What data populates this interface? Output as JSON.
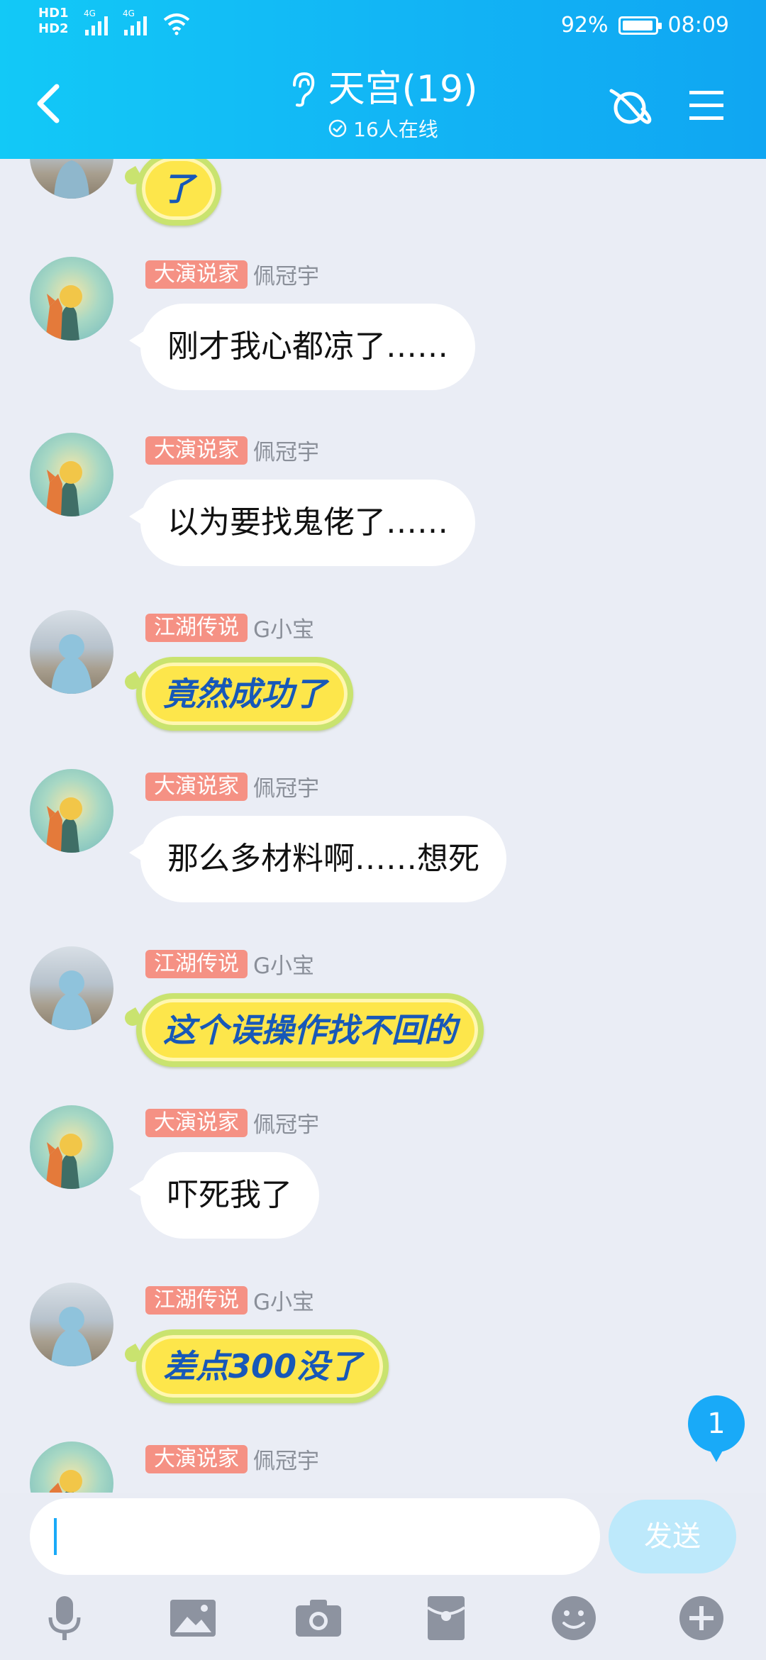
{
  "status_bar": {
    "sim": [
      "HD1",
      "HD2"
    ],
    "network": [
      "4G",
      "4G"
    ],
    "battery": "92%",
    "time": "08:09",
    "icons": [
      "signal-icon",
      "wifi-icon",
      "battery-icon"
    ]
  },
  "header": {
    "title": "天宫(19)",
    "online": "16人在线",
    "icons": [
      "back-icon",
      "ear-icon",
      "check-circle-icon",
      "planet-icon",
      "menu-icon"
    ]
  },
  "messages": [
    {
      "sender_badge": "",
      "sender": "",
      "text": "了",
      "style": "lemon",
      "avatar": "hood"
    },
    {
      "sender_badge": "大演说家",
      "sender": "佩冠宇",
      "text": "刚才我心都凉了……",
      "style": "plain",
      "avatar": "prince"
    },
    {
      "sender_badge": "大演说家",
      "sender": "佩冠宇",
      "text": "以为要找鬼佬了……",
      "style": "plain",
      "avatar": "prince"
    },
    {
      "sender_badge": "江湖传说",
      "sender": "G小宝",
      "text": "竟然成功了",
      "style": "lemon",
      "avatar": "hood"
    },
    {
      "sender_badge": "大演说家",
      "sender": "佩冠宇",
      "text": "那么多材料啊……想死",
      "style": "plain",
      "avatar": "prince"
    },
    {
      "sender_badge": "江湖传说",
      "sender": "G小宝",
      "text": "这个误操作找不回的",
      "style": "lemon",
      "avatar": "hood"
    },
    {
      "sender_badge": "大演说家",
      "sender": "佩冠宇",
      "text": "吓死我了",
      "style": "plain",
      "avatar": "prince"
    },
    {
      "sender_badge": "江湖传说",
      "sender": "G小宝",
      "text": "差点300没了",
      "style": "lemon",
      "avatar": "hood"
    },
    {
      "sender_badge": "大演说家",
      "sender": "佩冠宇",
      "text": "",
      "style": "plain",
      "avatar": "prince"
    }
  ],
  "unread_count": "1",
  "input": {
    "value": "",
    "placeholder": "",
    "send_label": "发送"
  },
  "toolbar": [
    "microphone-icon",
    "image-icon",
    "camera-icon",
    "red-packet-icon",
    "emoji-icon",
    "plus-icon"
  ],
  "colors": {
    "header": "#12b6f5",
    "badge": "#f59184",
    "lemon_bubble": "#fde64b",
    "lemon_text": "#1758b8",
    "send_button": "#bde9fb",
    "unread": "#19aaf8"
  }
}
